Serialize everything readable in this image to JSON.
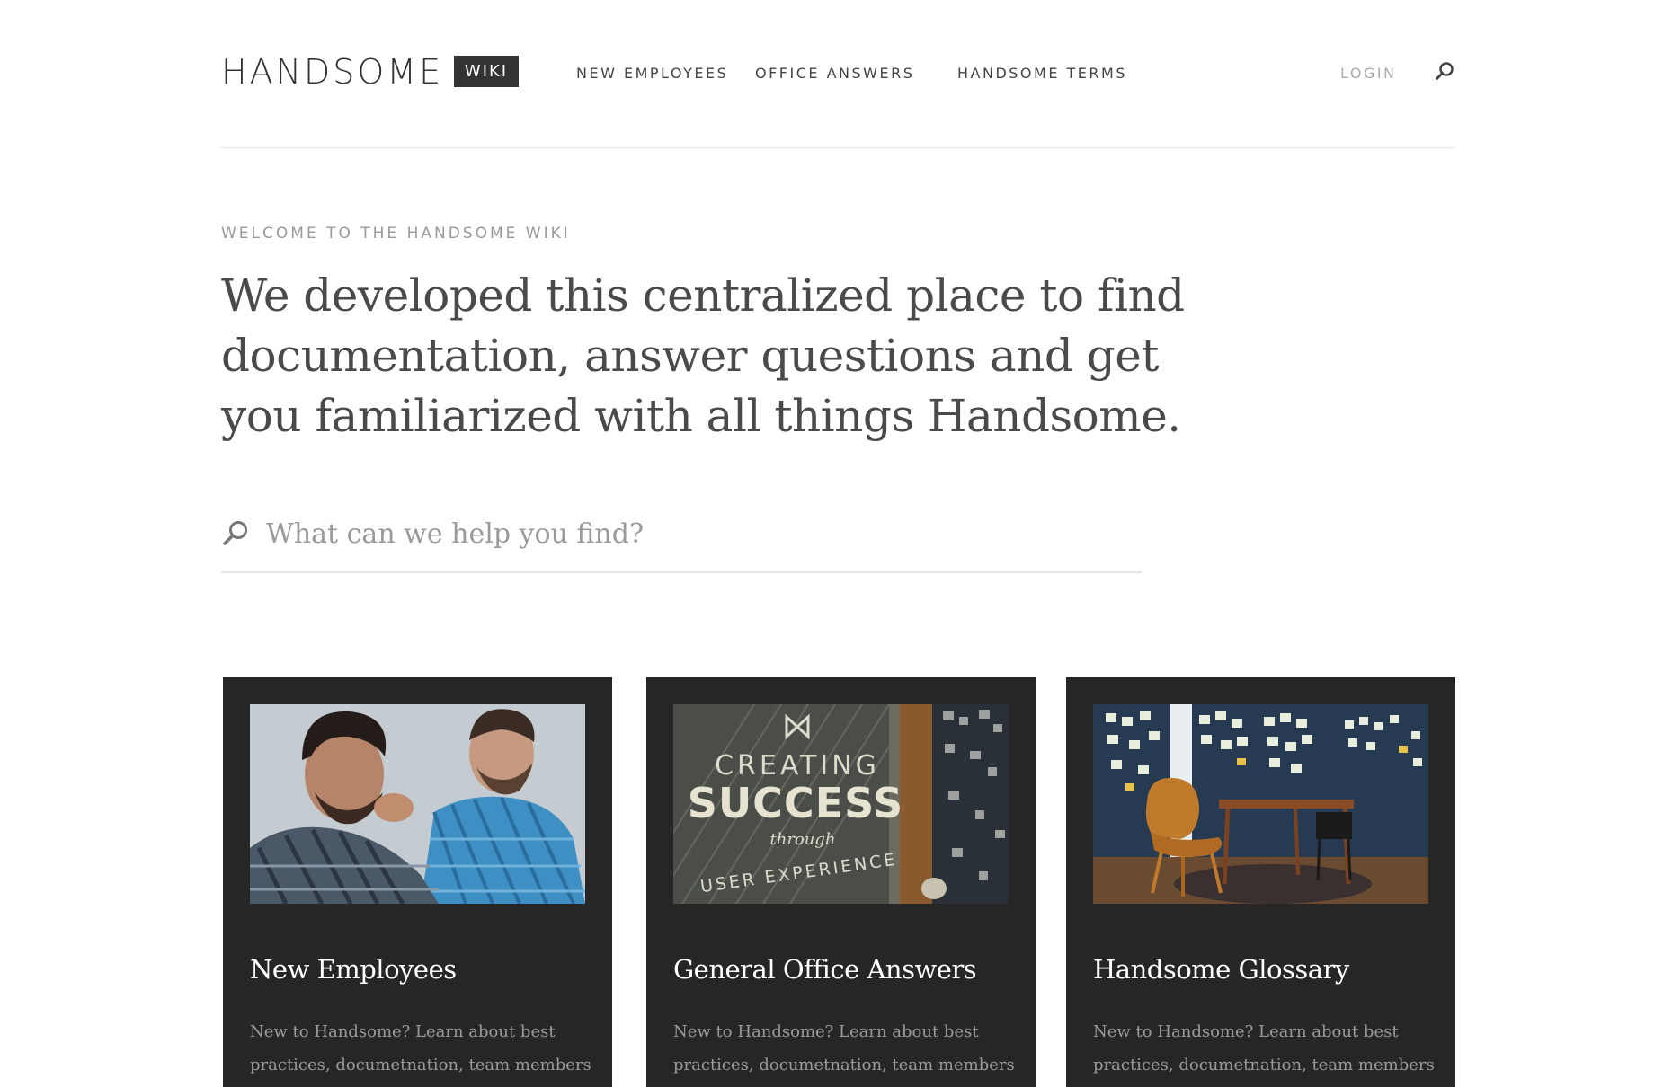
{
  "header": {
    "logo_text": "HANDSOME",
    "badge": "WIKI",
    "nav": [
      {
        "label": "NEW EMPLOYEES"
      },
      {
        "label": "OFFICE ANSWERS"
      },
      {
        "label": "HANDSOME TERMS"
      }
    ],
    "login": "LOGIN",
    "search_icon": "search-icon"
  },
  "hero": {
    "eyebrow": "WELCOME TO THE HANDSOME WIKI",
    "headline": "We developed this centralized place to find documentation, answer questions and get you familiarized with all things Handsome."
  },
  "search": {
    "placeholder": "What can we help you find?",
    "value": "",
    "icon": "search-icon"
  },
  "cards": [
    {
      "title": "New Employees",
      "description": "New to Handsome? Learn about best practices, documetnation, team members and more."
    },
    {
      "title": "General Office Answers",
      "description": "New to Handsome? Learn about best practices, documetnation, team members and more.",
      "image_text": {
        "line1": "CREATING",
        "line2": "SUCCESS",
        "line3": "through",
        "line4": "USER EXPERIENCE"
      }
    },
    {
      "title": "Handsome Glossary",
      "description": "New to Handsome? Learn about best practices, documetnation, team members and more."
    }
  ],
  "colors": {
    "text_dark": "#4a4a4a",
    "card_bg": "#262626",
    "badge_bg": "#333333",
    "muted": "#999999"
  }
}
